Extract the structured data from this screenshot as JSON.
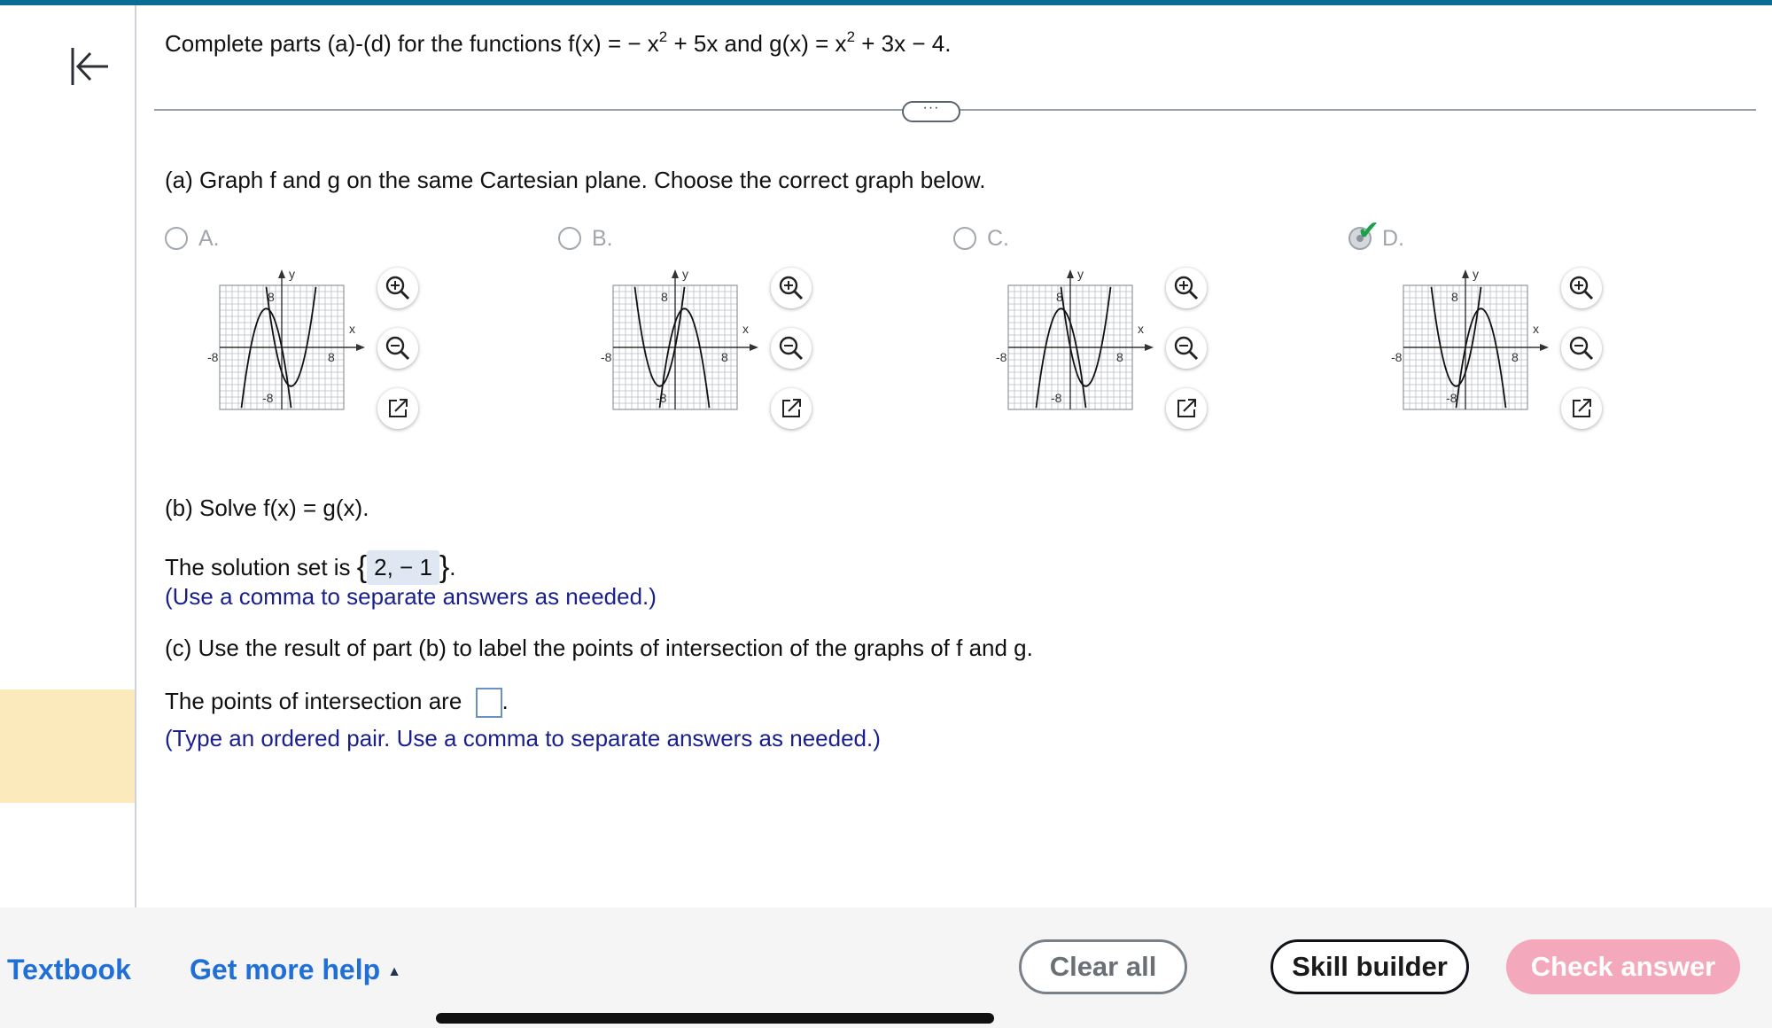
{
  "header": {
    "prefix": "Complete parts (a)-(d) for the functions f(x) =  − x",
    "sup1": "2",
    "mid": " + 5x and g(x) = x",
    "sup2": "2",
    "suffix": " + 3x − 4."
  },
  "more_button": "···",
  "part_a": {
    "prompt": "(a) Graph f and g on the same Cartesian plane. Choose the correct graph below.",
    "options": [
      {
        "letter": "A.",
        "selected": false
      },
      {
        "letter": "B.",
        "selected": false
      },
      {
        "letter": "C.",
        "selected": false
      },
      {
        "letter": "D.",
        "selected": true
      }
    ],
    "graph_labels": {
      "y": "y",
      "x": "x",
      "ymax": "8",
      "ymin": "-8",
      "xmin": "-8",
      "xmax": "8"
    }
  },
  "part_b": {
    "prompt": "(b) Solve f(x) = g(x).",
    "solution_prefix": "The solution set is ",
    "brace_open": "{",
    "answer": "2, − 1",
    "brace_close": "}",
    "period": ".",
    "hint": "(Use a comma to separate answers as needed.)"
  },
  "part_c": {
    "prompt": "(c) Use the result of part (b) to label the points of intersection of the graphs of f and g.",
    "points_prefix": "The points of intersection are ",
    "period": ".",
    "hint": "(Type an ordered pair. Use a comma to separate answers as needed.)"
  },
  "footer": {
    "textbook": "Textbook",
    "help": "Get more help",
    "clear": "Clear all",
    "skill": "Skill builder",
    "check": "Check answer"
  },
  "colors": {
    "accent": "#1f6fd6",
    "topbar": "#0a6e94",
    "check_answer": "#f4a8bb",
    "hint": "#1a1f8c",
    "sidebar_highlight": "#faeabc",
    "correct": "#19a24a"
  },
  "icons": [
    "collapse-left-icon",
    "zoom-in-icon",
    "zoom-out-icon",
    "external-link-icon",
    "checkmark-icon",
    "caret-up-icon"
  ]
}
